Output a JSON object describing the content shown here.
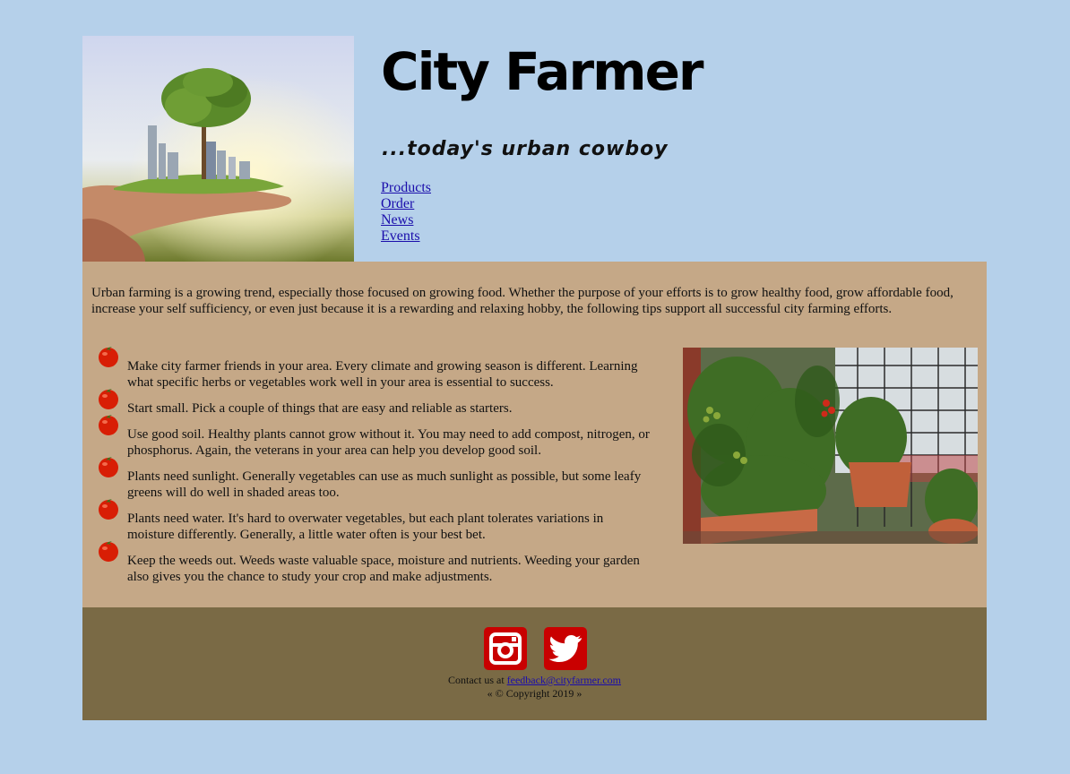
{
  "header": {
    "title": "City Farmer",
    "tagline": "...today's urban cowboy",
    "nav": [
      "Products",
      "Order",
      "News",
      "Events"
    ]
  },
  "main": {
    "intro": "Urban farming is a growing trend, especially those focused on growing food. Whether the purpose of your efforts is to grow healthy food, grow affordable food, increase your self sufficiency, or even just because it is a rewarding and relaxing hobby, the following tips support all successful city farming efforts.",
    "tips": [
      "Make city farmer friends in your area. Every climate and growing season is different. Learning what specific herbs or vegetables work well in your area is essential to success.",
      "Start small. Pick a couple of things that are easy and reliable as starters.",
      "Use good soil. Healthy plants cannot grow without it. You may need to add compost, nitrogen, or phosphorus. Again, the veterans in your area can help you develop good soil.",
      "Plants need sunlight. Generally vegetables can use as much sunlight as possible, but some leafy greens will do well in shaded areas too.",
      "Plants need water. It's hard to overwater vegetables, but each plant tolerates variations in moisture differently. Generally, a little water often is your best bet.",
      "Keep the weeds out. Weeds waste valuable space, moisture and nutrients. Weeding your garden also gives you the chance to study your crop and make adjustments."
    ]
  },
  "footer": {
    "contact_prefix": "Contact us at ",
    "email": "feedback@cityfarmer.com",
    "copyright": "« © Copyright 2019 »",
    "icons": [
      "instagram-icon",
      "twitter-icon"
    ]
  },
  "colors": {
    "page_bg": "#b5d0ea",
    "main_bg": "#c5a887",
    "footer_bg": "#7a6a45",
    "social_red": "#c90000",
    "link": "#1a0dab"
  }
}
